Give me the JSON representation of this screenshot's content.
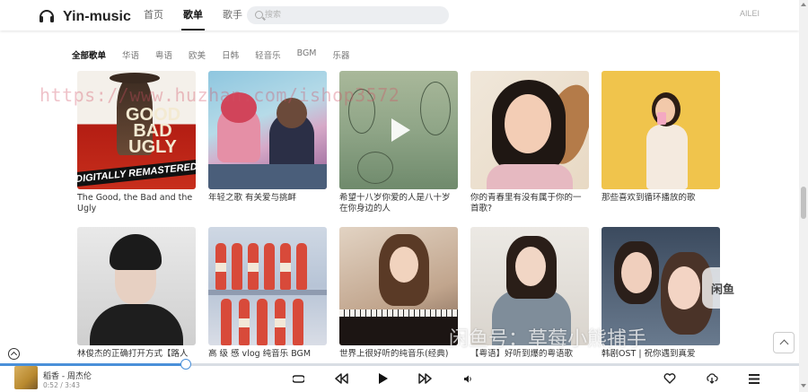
{
  "app": {
    "name": "Yin-music",
    "user": "AILEI"
  },
  "nav": [
    {
      "label": "首页",
      "active": false
    },
    {
      "label": "歌单",
      "active": true
    },
    {
      "label": "歌手",
      "active": false
    }
  ],
  "search": {
    "placeholder": "搜索",
    "value": ""
  },
  "categories": [
    "全部歌单",
    "华语",
    "粤语",
    "欧美",
    "日韩",
    "轻音乐",
    "BGM",
    "乐器"
  ],
  "active_category": "全部歌单",
  "playlists": [
    {
      "title": "The Good, the Bad and the Ugly",
      "cover": "western movie poster",
      "cover_text": "GOOD BAD UGLY",
      "cover_band": "DIGITALLY REMASTERED"
    },
    {
      "title": "年轻之歌 有关爱与挑衅",
      "cover": "illustration couple"
    },
    {
      "title": "希望十八岁你爱的人是八十岁在你身边的人",
      "cover": "green illustration",
      "hover_play": true
    },
    {
      "title": "你的青春里有没有属于你的一首歌?",
      "cover": "smiling girl with leaf"
    },
    {
      "title": "那些喜欢到循环播放的歌",
      "cover": "girl on yellow wall"
    },
    {
      "title": "林俊杰的正确打开方式【路人",
      "cover": "male singer portrait"
    },
    {
      "title": "高 级 感 vlog 纯音乐 BGM",
      "cover": "red bottles"
    },
    {
      "title": "世界上很好听的纯音乐(经典)",
      "cover": "girl at piano"
    },
    {
      "title": "【粤语】好听到爆的粤语歌",
      "cover": "girl in coat"
    },
    {
      "title": "韩剧OST | 祝你遇到真爱",
      "cover": "korean drama couple"
    }
  ],
  "watermarks": {
    "url": "https://www.huzhan.com/ishop3572",
    "cn": "闲鱼号：草莓小熊捕手",
    "badge": "闲鱼"
  },
  "player": {
    "song": "稻香 - 周杰伦",
    "current_time": "0:52",
    "total_time": "3:43",
    "time_display": "0:52 / 3:43",
    "progress": 0.233
  },
  "icons": {
    "logo": "headphones-icon",
    "loop": "loop-icon",
    "prev": "prev-icon",
    "play": "play-icon",
    "next": "next-icon",
    "volume": "volume-icon",
    "like": "heart-icon",
    "download": "download-icon",
    "playlist": "playlist-icon",
    "back_top": "chevron-up-icon",
    "expand": "expand-icon"
  },
  "colors": {
    "accent": "#4a90d9",
    "text": "#333333"
  }
}
